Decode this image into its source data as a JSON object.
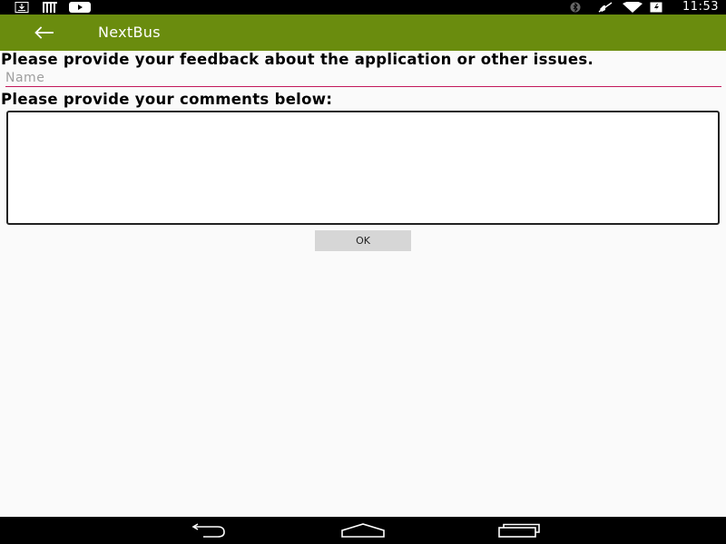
{
  "status_bar": {
    "time": "11:53",
    "left_icons": [
      "download-icon",
      "barcode-icon",
      "youtube-icon"
    ],
    "right_icons": [
      "bluetooth-icon",
      "mute-icon",
      "wifi-icon",
      "battery-icon"
    ]
  },
  "app_bar": {
    "title": "NextBus",
    "back_icon": "arrow-left-icon",
    "color": "#6a8c0e"
  },
  "form": {
    "heading": "Please provide your feedback about the application or other issues.",
    "name_placeholder": "Name",
    "name_value": "",
    "comments_label": "Please provide your comments below:",
    "comments_value": "",
    "ok_label": "OK"
  },
  "nav_bar": {
    "buttons": [
      "back-icon",
      "home-icon",
      "recents-icon"
    ]
  }
}
